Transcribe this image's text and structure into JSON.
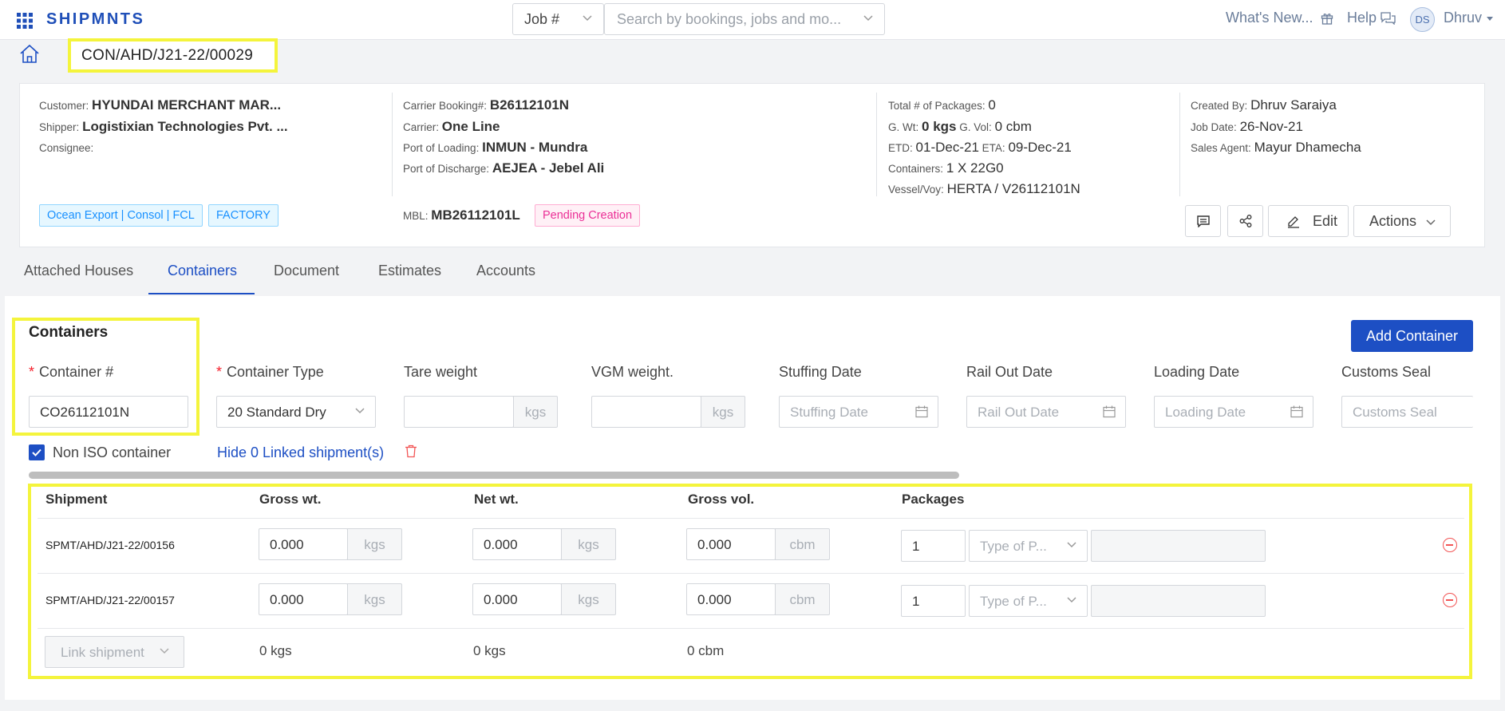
{
  "app": {
    "brand": "SHIPMNTS"
  },
  "topbar": {
    "job_select": "Job #",
    "search_placeholder": "Search by bookings, jobs and mo...",
    "whats_new": "What's New...",
    "help": "Help",
    "avatar_initials": "DS",
    "user_name": "Dhruv"
  },
  "job_number": "CON/AHD/J21-22/00029",
  "header": {
    "col1": {
      "customer_label": "Customer:",
      "customer": "HYUNDAI MERCHANT MAR...",
      "shipper_label": "Shipper:",
      "shipper": "Logistixian Technologies Pvt. ...",
      "consignee_label": "Consignee:"
    },
    "col2": {
      "carrier_booking_label": "Carrier Booking#:",
      "carrier_booking": "B26112101N",
      "carrier_label": "Carrier:",
      "carrier": "One Line",
      "pol_label": "Port of Loading:",
      "pol": "INMUN - Mundra",
      "pod_label": "Port of Discharge:",
      "pod": "AEJEA - Jebel Ali",
      "mbl_label": "MBL:",
      "mbl": "MB26112101L",
      "mbl_status": "Pending Creation"
    },
    "col3": {
      "packages_label": "Total # of Packages:",
      "packages": "0",
      "gwt_label": "G. Wt:",
      "gwt": "0 kgs",
      "gvol_label": "G. Vol:",
      "gvol": "0 cbm",
      "etd_label": "ETD:",
      "etd": "01-Dec-21",
      "eta_label": "ETA:",
      "eta": "09-Dec-21",
      "containers_label": "Containers:",
      "containers": "1 X 22G0",
      "vessel_label": "Vessel/Voy:",
      "vessel": "HERTA / V26112101N"
    },
    "col4": {
      "created_by_label": "Created By:",
      "created_by": "Dhruv Saraiya",
      "job_date_label": "Job Date:",
      "job_date": "26-Nov-21",
      "sales_agent_label": "Sales Agent:",
      "sales_agent": "Mayur Dhamecha"
    },
    "tags": [
      "Ocean Export | Consol | FCL",
      "FACTORY"
    ],
    "buttons": {
      "edit": "Edit",
      "actions": "Actions"
    }
  },
  "tabs": [
    "Attached Houses",
    "Containers",
    "Document",
    "Estimates",
    "Accounts"
  ],
  "containers": {
    "title": "Containers",
    "add_button": "Add Container",
    "labels": {
      "container_no": "Container #",
      "container_type": "Container Type",
      "tare_weight": "Tare weight",
      "vgm_weight": "VGM weight.",
      "stuffing_date": "Stuffing Date",
      "rail_out_date": "Rail Out Date",
      "loading_date": "Loading Date",
      "customs_seal": "Customs Seal"
    },
    "values": {
      "container_no": "CO26112101N",
      "container_type": "20 Standard Dry",
      "weight_unit": "kgs"
    },
    "placeholders": {
      "stuffing_date": "Stuffing Date",
      "rail_out_date": "Rail Out Date",
      "loading_date": "Loading Date",
      "customs_seal": "Customs Seal"
    },
    "non_iso_label": "Non ISO container",
    "non_iso_checked": true,
    "linked_link": "Hide 0 Linked shipment(s)"
  },
  "table": {
    "headers": [
      "Shipment",
      "Gross wt.",
      "Net wt.",
      "Gross vol.",
      "Packages"
    ],
    "rows": [
      {
        "shipment": "SPMT/AHD/J21-22/00156",
        "gross_wt": "0.000",
        "net_wt": "0.000",
        "gross_vol": "0.000",
        "packages": "1",
        "pkg_type_placeholder": "Type of P..."
      },
      {
        "shipment": "SPMT/AHD/J21-22/00157",
        "gross_wt": "0.000",
        "net_wt": "0.000",
        "gross_vol": "0.000",
        "packages": "1",
        "pkg_type_placeholder": "Type of P..."
      }
    ],
    "units": {
      "wt": "kgs",
      "vol": "cbm"
    },
    "link_shipment": "Link shipment",
    "totals": {
      "gross_wt": "0 kgs",
      "net_wt": "0 kgs",
      "gross_vol": "0 cbm"
    }
  }
}
